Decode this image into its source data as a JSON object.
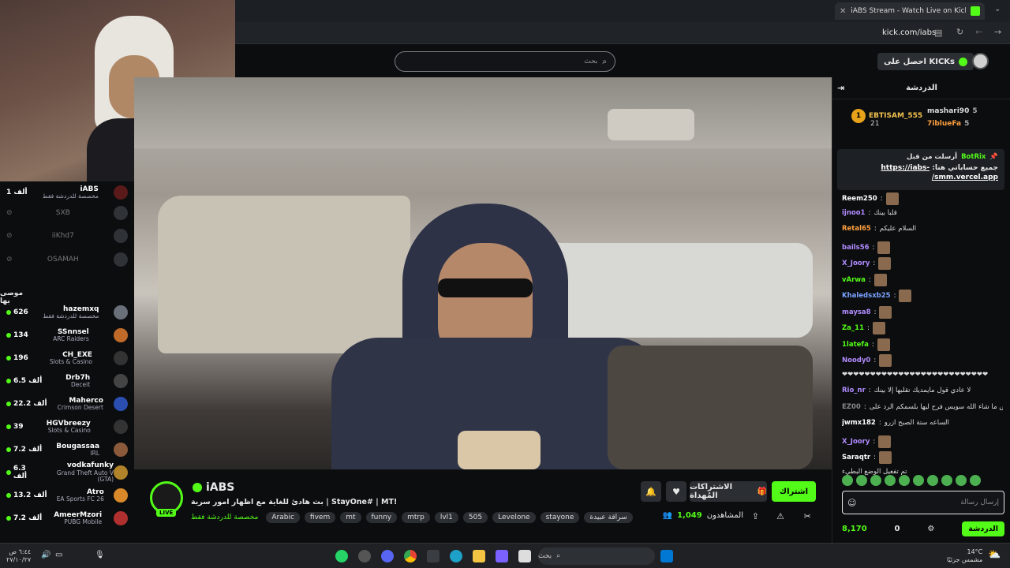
{
  "browser": {
    "tab_title": "iABS Stream - Watch Live on Kick",
    "url": "kick.com/iabs"
  },
  "header": {
    "search_placeholder": "بحث",
    "kicks_button": "احصل على KICKs"
  },
  "sidebar": {
    "following": [
      {
        "count": "1 ألف",
        "name": "iABS",
        "sub": "مخصصة للدردشة فقط",
        "live": true
      },
      {
        "name": "SXB",
        "live": false
      },
      {
        "name": "iiKhd7",
        "live": false
      },
      {
        "name": "OSAMAH",
        "live": false
      }
    ],
    "recommended_heading": "موصى بها",
    "recommended": [
      {
        "count": "626",
        "name": "hazemxq",
        "sub": "مخصصة للدردشة فقط"
      },
      {
        "count": "134",
        "name": "SSnnsel",
        "sub": "ARC Raiders"
      },
      {
        "count": "196",
        "name": "CH_EXE",
        "sub": "Slots & Casino"
      },
      {
        "count": "6.5 ألف",
        "name": "Drb7h",
        "sub": "Deceit"
      },
      {
        "count": "22.2 ألف",
        "name": "Maherco",
        "sub": "Crimson Desert"
      },
      {
        "count": "39",
        "name": "HGVbreezy",
        "sub": "Slots & Casino"
      },
      {
        "count": "7.2 ألف",
        "name": "Bougassaa",
        "sub": "IRL"
      },
      {
        "count": "6.3 ألف",
        "name": "vodkafunky",
        "sub": "Grand Theft Auto V (GTA)"
      },
      {
        "count": "13.2 ألف",
        "name": "Atro",
        "sub": "EA Sports FC 26"
      },
      {
        "count": "7.2 ألف",
        "name": "AmeerMzori",
        "sub": "PUBG Mobile"
      }
    ]
  },
  "stream": {
    "channel_name": "iABS",
    "live_badge": "LIVE",
    "title": "بث هادئ للغاية مع اظهار امور سرية | StayOne# | MT!",
    "category": "مخصصة للدردشة فقط",
    "tags": [
      "Arabic",
      "fivem",
      "mt",
      "funny",
      "mtrp",
      "lvl1",
      "505",
      "Levelone",
      "stayone",
      "سراقة عبيدة"
    ],
    "subscribe_label": "اشتراك",
    "gift_label": "الاشتراكات المُهداة",
    "viewers_label": "المشاهدون",
    "viewers_count": "1,049"
  },
  "chat": {
    "title": "الدردشة",
    "leaders": [
      {
        "rank": "1",
        "name": "EBTISAM_555",
        "value": "21"
      },
      {
        "name": "mashari90",
        "value": "5"
      },
      {
        "name": "7iblueFa",
        "value": "5"
      }
    ],
    "pinned": {
      "header": "أرسلت من قبل",
      "author": "BotRix",
      "body": "جميع حساباتي هنا:",
      "link": "https://iabs-smm.vercel.app/"
    },
    "messages": [
      {
        "user": "Reem250",
        "text": "",
        "color": "#ffffff"
      },
      {
        "user": "ijnoo1",
        "text": "قلبا بينك",
        "color": "#b18cff"
      },
      {
        "user": "Retal65",
        "text": "السلام عليكم",
        "color": "#ff9f40"
      },
      {
        "user": "bails56",
        "text": "",
        "color": "#b18cff"
      },
      {
        "user": "X_Joory",
        "text": "",
        "color": "#b18cff"
      },
      {
        "user": "vArwa",
        "text": "",
        "color": "#53fc18"
      },
      {
        "user": "Khaledsxb25",
        "text": "",
        "color": "#7aa2ff"
      },
      {
        "user": "maysa8",
        "text": "",
        "color": "#b18cff"
      },
      {
        "user": "Za_11",
        "text": "",
        "color": "#53fc18"
      },
      {
        "user": "1latefa",
        "text": "",
        "color": "#53fc18"
      },
      {
        "user": "Noody0",
        "text": "",
        "color": "#b18cff"
      },
      {
        "user": "",
        "text": "❤❤❤❤❤❤❤❤❤❤❤❤❤❤❤❤❤❤❤❤❤❤❤❤❤❤",
        "color": "#ffffff"
      },
      {
        "user": "Rio_nr",
        "text": "لا عادي قول مايمديك تقلبها إلا بينك",
        "color": "#b18cff"
      },
      {
        "user": "EZ00",
        "text": "يس ما شاء الله سويس فرح ليها بلسمكم الرد على",
        "color": "#888888"
      },
      {
        "user": "jwmx182",
        "text": "الساعه ستة الصبح ازرو",
        "color": "#ffffff"
      },
      {
        "user": "X_Joory",
        "text": "",
        "color": "#b18cff"
      },
      {
        "user": "Saraqtr",
        "text": "",
        "color": "#ffffff"
      },
      {
        "user": "",
        "text": "تم تفعيل الوضع البطيء",
        "color": "#aaaaaa"
      }
    ],
    "input_placeholder": "إرسال رسالة",
    "send_label": "الدردشة",
    "kicks_balance": "8,170",
    "points": "0"
  },
  "taskbar": {
    "search_placeholder": "بحث",
    "weather_temp": "14°C",
    "weather_desc": "مشمس جزئيًا",
    "time": "٦:٤٤ ص",
    "date": "٢٧/١٠/٢٧"
  },
  "colors": {
    "accent": "#53fc18",
    "background": "#0b0d0f",
    "panel": "#2b2f34"
  }
}
